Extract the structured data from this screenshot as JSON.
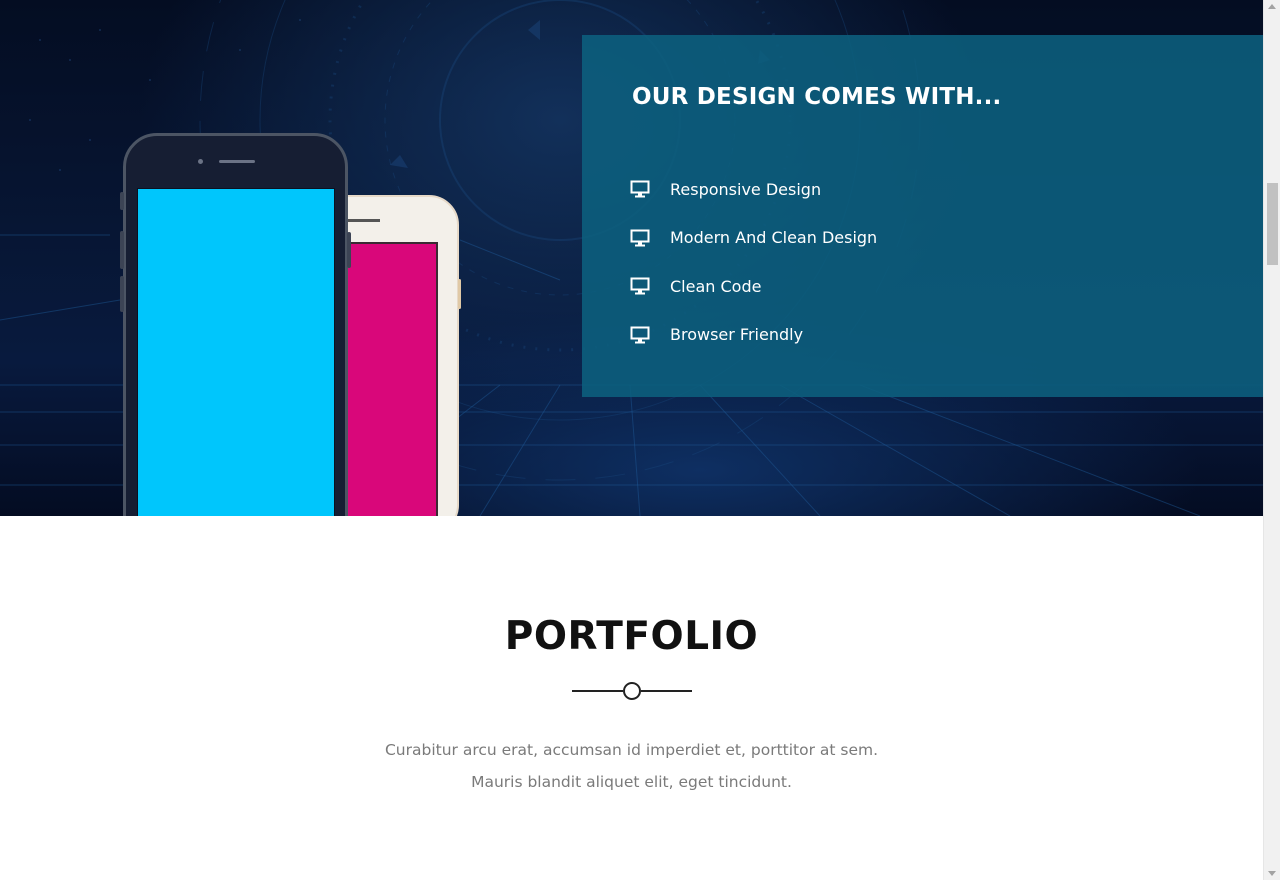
{
  "hero": {
    "feature_title": "OUR DESIGN COMES WITH...",
    "features": [
      {
        "label": "Responsive Design",
        "icon": "desktop-icon"
      },
      {
        "label": "Modern And Clean Design",
        "icon": "desktop-icon"
      },
      {
        "label": "Clean Code",
        "icon": "desktop-icon"
      },
      {
        "label": "Browser Friendly",
        "icon": "desktop-icon"
      }
    ],
    "phone_screen_colors": {
      "front": "#00c6fc",
      "back": "#d9077a"
    },
    "panel_color": "#0c607e"
  },
  "portfolio": {
    "title": "PORTFOLIO",
    "description": "Curabitur arcu erat, accumsan id imperdiet et, porttitor at sem. Mauris blandit aliquet elit, eget tincidunt."
  }
}
